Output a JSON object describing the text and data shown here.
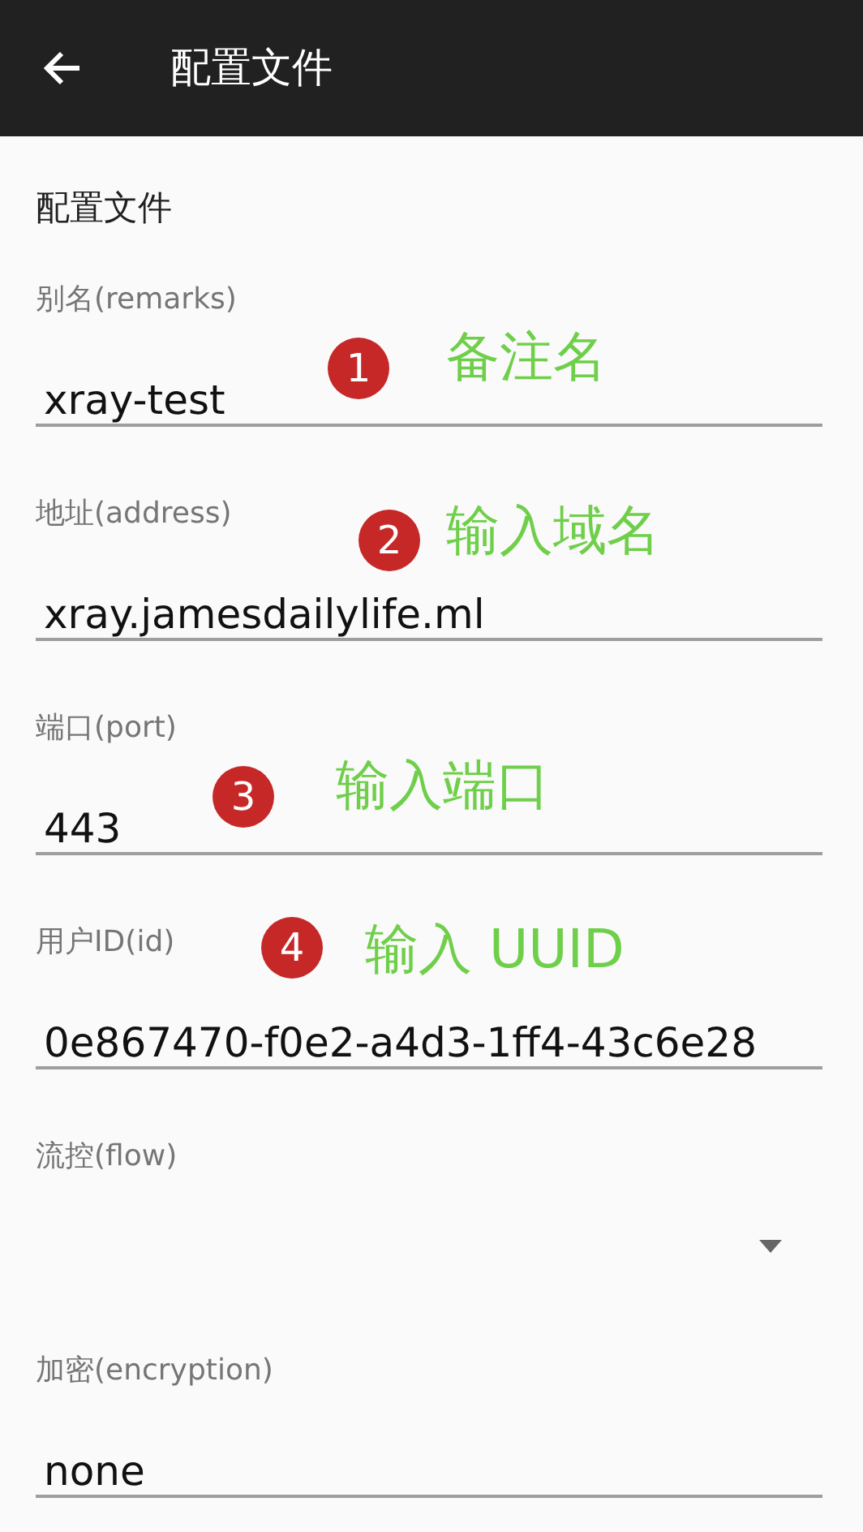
{
  "app_bar": {
    "title": "配置文件"
  },
  "section_title": "配置文件",
  "fields": [
    {
      "kind": "text",
      "label": "别名(remarks)",
      "value": "xray-test",
      "annotation": {
        "number": "1",
        "text": "备注名"
      }
    },
    {
      "kind": "text",
      "label": "地址(address)",
      "value": "xray.jamesdailylife.ml",
      "annotation": {
        "number": "2",
        "text": "输入域名"
      }
    },
    {
      "kind": "text",
      "label": "端口(port)",
      "value": "443",
      "annotation": {
        "number": "3",
        "text": "输入端口"
      }
    },
    {
      "kind": "text",
      "label": "用户ID(id)",
      "value": "0e867470-f0e2-a4d3-1ff4-43c6e28",
      "annotation": {
        "number": "4",
        "text": "输入 UUID"
      }
    },
    {
      "kind": "dropdown",
      "label": "流控(flow)"
    },
    {
      "kind": "text",
      "label": "加密(encryption)",
      "value": "none"
    }
  ]
}
